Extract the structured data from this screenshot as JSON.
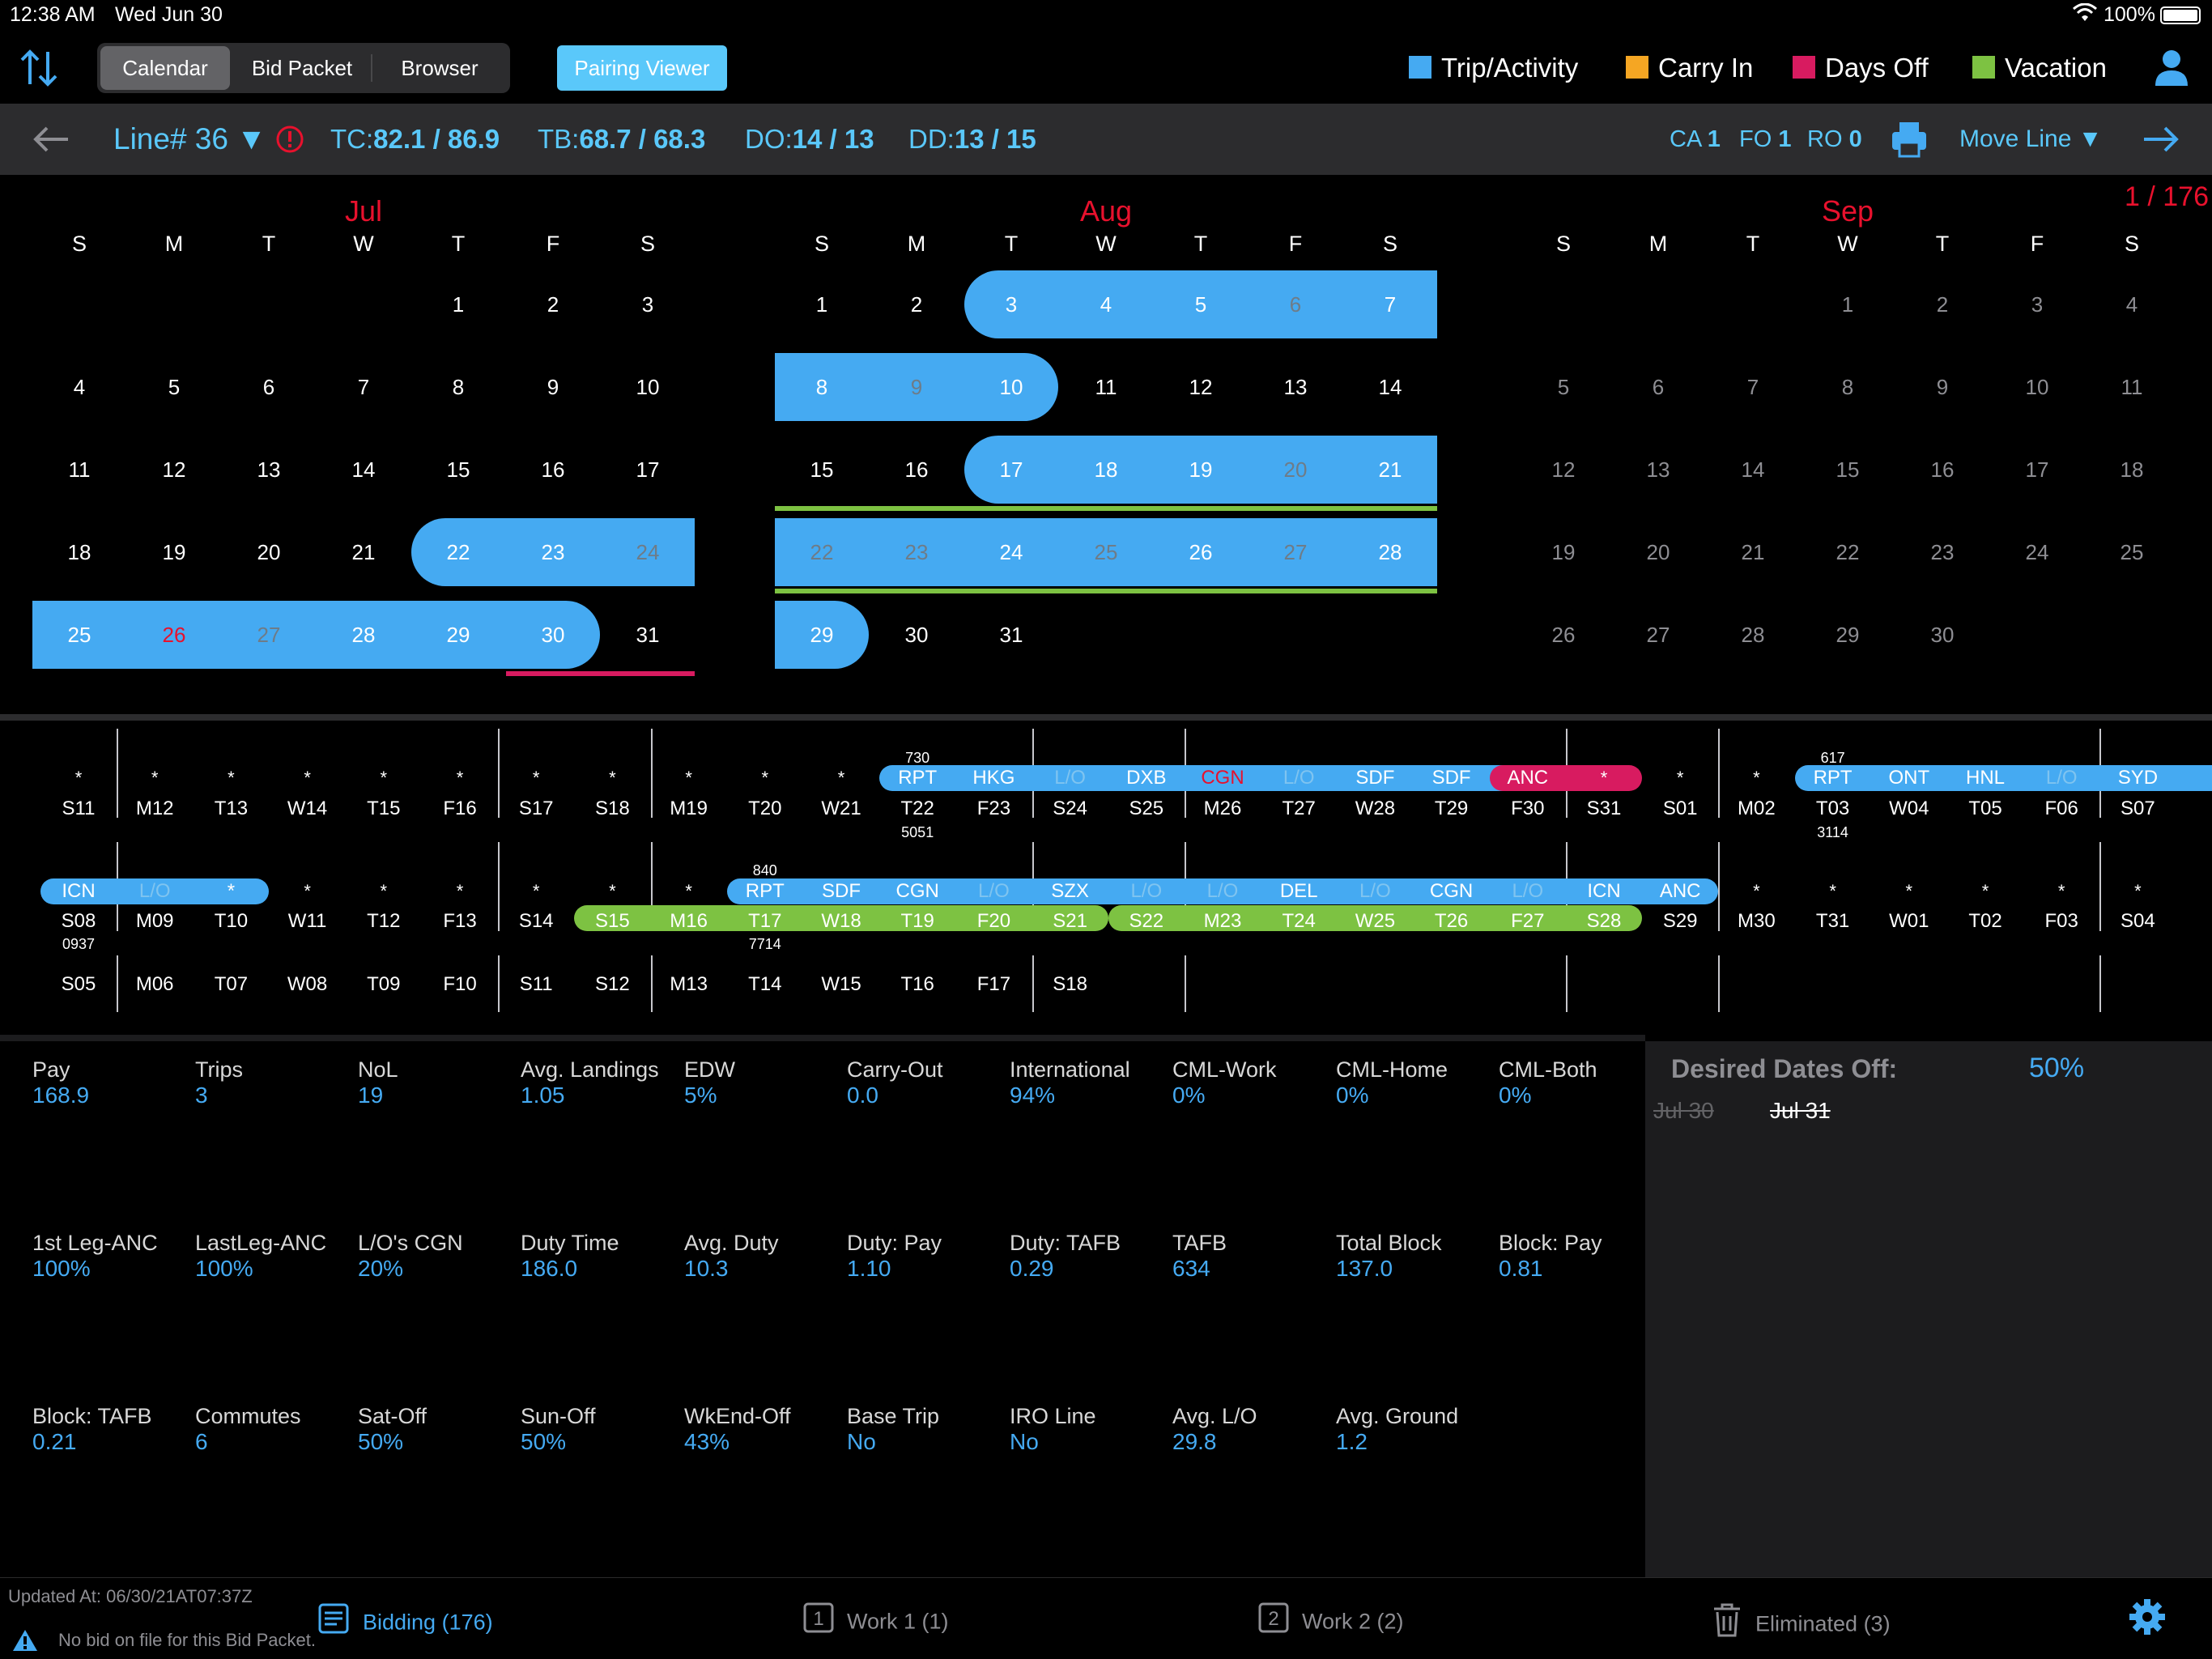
{
  "status_bar": {
    "time": "12:38 AM",
    "date": "Wed Jun 30",
    "battery": "100%"
  },
  "toolbar": {
    "segments": [
      "Calendar",
      "Bid Packet",
      "Browser"
    ],
    "pairing_viewer": "Pairing Viewer",
    "legend": [
      {
        "label": "Trip/Activity",
        "color": "#45aaf2"
      },
      {
        "label": "Carry In",
        "color": "#f5a623"
      },
      {
        "label": "Days Off",
        "color": "#d81b60"
      },
      {
        "label": "Vacation",
        "color": "#7dc242"
      }
    ]
  },
  "line_bar": {
    "line": "Line# 36",
    "tc_label": "TC:",
    "tc": "82.1 / 86.9",
    "tb_label": "TB:",
    "tb": "68.7 / 68.3",
    "do_label": "DO:",
    "do": "14 / 13",
    "dd_label": "DD:",
    "dd": "13 / 15",
    "ca_label": "CA",
    "ca": "1",
    "fo_label": "FO",
    "fo": "1",
    "ro_label": "RO",
    "ro": "0",
    "move_line": "Move Line ▼",
    "counter": "1 / 176"
  },
  "calendar": {
    "weekdays": [
      "S",
      "M",
      "T",
      "W",
      "T",
      "F",
      "S"
    ],
    "months": [
      {
        "name": "Jul",
        "weeks": [
          [
            "",
            "",
            "",
            "",
            "1",
            "2",
            "3"
          ],
          [
            "4",
            "5",
            "6",
            "7",
            "8",
            "9",
            "10"
          ],
          [
            "11",
            "12",
            "13",
            "14",
            "15",
            "16",
            "17"
          ],
          [
            "18",
            "19",
            "20",
            "21",
            "22",
            "23",
            "24"
          ],
          [
            "25",
            "26",
            "27",
            "28",
            "29",
            "30",
            "31"
          ]
        ]
      },
      {
        "name": "Aug",
        "weeks": [
          [
            "1",
            "2",
            "3",
            "4",
            "5",
            "6",
            "7"
          ],
          [
            "8",
            "9",
            "10",
            "11",
            "12",
            "13",
            "14"
          ],
          [
            "15",
            "16",
            "17",
            "18",
            "19",
            "20",
            "21"
          ],
          [
            "22",
            "23",
            "24",
            "25",
            "26",
            "27",
            "28"
          ],
          [
            "29",
            "30",
            "31",
            "",
            "",
            "",
            ""
          ]
        ]
      },
      {
        "name": "Sep",
        "weeks": [
          [
            "",
            "",
            "",
            "1",
            "2",
            "3",
            "4"
          ],
          [
            "5",
            "6",
            "7",
            "8",
            "9",
            "10",
            "11"
          ],
          [
            "12",
            "13",
            "14",
            "15",
            "16",
            "17",
            "18"
          ],
          [
            "19",
            "20",
            "21",
            "22",
            "23",
            "24",
            "25"
          ],
          [
            "26",
            "27",
            "28",
            "29",
            "30",
            "",
            ""
          ]
        ]
      }
    ]
  },
  "timeline": {
    "row1": {
      "days": [
        "S11",
        "M12",
        "T13",
        "W14",
        "T15",
        "F16",
        "S17",
        "S18",
        "M19",
        "T20",
        "W21",
        "T22",
        "F23",
        "S24",
        "S25",
        "M26",
        "T27",
        "W28",
        "T29",
        "F30",
        "S31",
        "S01",
        "M02",
        "T03",
        "W04",
        "T05",
        "F06",
        "S07"
      ],
      "stars": [
        "*",
        "*",
        "*",
        "*",
        "*",
        "*",
        "*",
        "*",
        "*",
        "*",
        "*",
        "",
        "",
        "",
        "",
        "",
        "",
        "",
        "",
        "",
        "*",
        "*",
        "*",
        "",
        "",
        "",
        "",
        ""
      ],
      "trip_a_airports": [
        "RPT",
        "HKG",
        "L/O",
        "DXB",
        "CGN",
        "L/O",
        "SDF",
        "SDF",
        "ANC"
      ],
      "trip_a_top": "730",
      "trip_a_bottom": "5051",
      "trip_b_airports": [
        "RPT",
        "ONT",
        "HNL",
        "L/O",
        "SYD"
      ],
      "trip_b_top": "617",
      "trip_b_bottom": "3114"
    },
    "row2": {
      "days": [
        "S08",
        "M09",
        "T10",
        "W11",
        "T12",
        "F13",
        "S14",
        "S15",
        "M16",
        "T17",
        "W18",
        "T19",
        "F20",
        "S21",
        "S22",
        "M23",
        "T24",
        "W25",
        "T26",
        "F27",
        "S28",
        "S29",
        "M30",
        "T31",
        "W01",
        "T02",
        "F03",
        "S04"
      ],
      "stars": [
        "",
        "",
        "",
        "*",
        "*",
        "*",
        "*",
        "*",
        "*",
        "",
        "",
        "",
        "",
        "",
        "",
        "",
        "",
        "",
        "",
        "",
        "",
        "",
        "*",
        "*",
        "*",
        "*",
        "*",
        "*"
      ],
      "trip_a_airports": [
        "ICN",
        "L/O",
        "*"
      ],
      "trip_a_bottom": "0937",
      "trip_b_airports": [
        "RPT",
        "SDF",
        "CGN",
        "L/O",
        "SZX",
        "L/O",
        "L/O",
        "DEL",
        "L/O",
        "CGN",
        "L/O",
        "ICN",
        "ANC"
      ],
      "trip_b_top": "840",
      "trip_b_bottom": "7714"
    },
    "row3": {
      "days": [
        "S05",
        "M06",
        "T07",
        "W08",
        "T09",
        "F10",
        "S11",
        "S12",
        "M13",
        "T14",
        "W15",
        "T16",
        "F17",
        "S18"
      ]
    }
  },
  "stats": [
    {
      "label": "Pay",
      "value": "168.9"
    },
    {
      "label": "Trips",
      "value": "3"
    },
    {
      "label": "NoL",
      "value": "19"
    },
    {
      "label": "Avg. Landings",
      "value": "1.05"
    },
    {
      "label": "EDW",
      "value": "5%"
    },
    {
      "label": "Carry-Out",
      "value": "0.0"
    },
    {
      "label": "International",
      "value": "94%"
    },
    {
      "label": "CML-Work",
      "value": "0%"
    },
    {
      "label": "CML-Home",
      "value": "0%"
    },
    {
      "label": "CML-Both",
      "value": "0%"
    },
    {
      "label": "1st Leg-ANC",
      "value": "100%"
    },
    {
      "label": "LastLeg-ANC",
      "value": "100%"
    },
    {
      "label": "L/O's CGN",
      "value": "20%"
    },
    {
      "label": "Duty Time",
      "value": "186.0"
    },
    {
      "label": "Avg. Duty",
      "value": "10.3"
    },
    {
      "label": "Duty: Pay",
      "value": "1.10"
    },
    {
      "label": "Duty: TAFB",
      "value": "0.29"
    },
    {
      "label": "TAFB",
      "value": "634"
    },
    {
      "label": "Total Block",
      "value": "137.0"
    },
    {
      "label": "Block: Pay",
      "value": "0.81"
    },
    {
      "label": "Block: TAFB",
      "value": "0.21"
    },
    {
      "label": "Commutes",
      "value": "6"
    },
    {
      "label": "Sat-Off",
      "value": "50%"
    },
    {
      "label": "Sun-Off",
      "value": "50%"
    },
    {
      "label": "WkEnd-Off",
      "value": "43%"
    },
    {
      "label": "Base Trip",
      "value": "No"
    },
    {
      "label": "IRO Line",
      "value": "No"
    },
    {
      "label": "Avg. L/O",
      "value": "29.8"
    },
    {
      "label": "Avg. Ground",
      "value": "1.2"
    }
  ],
  "desired": {
    "title": "Desired Dates Off:",
    "percent": "50%",
    "dates": [
      "Jul 30",
      "Jul 31"
    ]
  },
  "footer": {
    "updated": "Updated At: 06/30/21AT07:37Z",
    "warning": "No bid on file for this Bid Packet.",
    "tabs": [
      {
        "label": "Bidding (176)",
        "icon": "list-icon"
      },
      {
        "label": "Work 1 (1)",
        "icon": "one-box-icon"
      },
      {
        "label": "Work 2 (2)",
        "icon": "two-box-icon"
      },
      {
        "label": "Eliminated (3)",
        "icon": "trash-icon"
      }
    ]
  }
}
